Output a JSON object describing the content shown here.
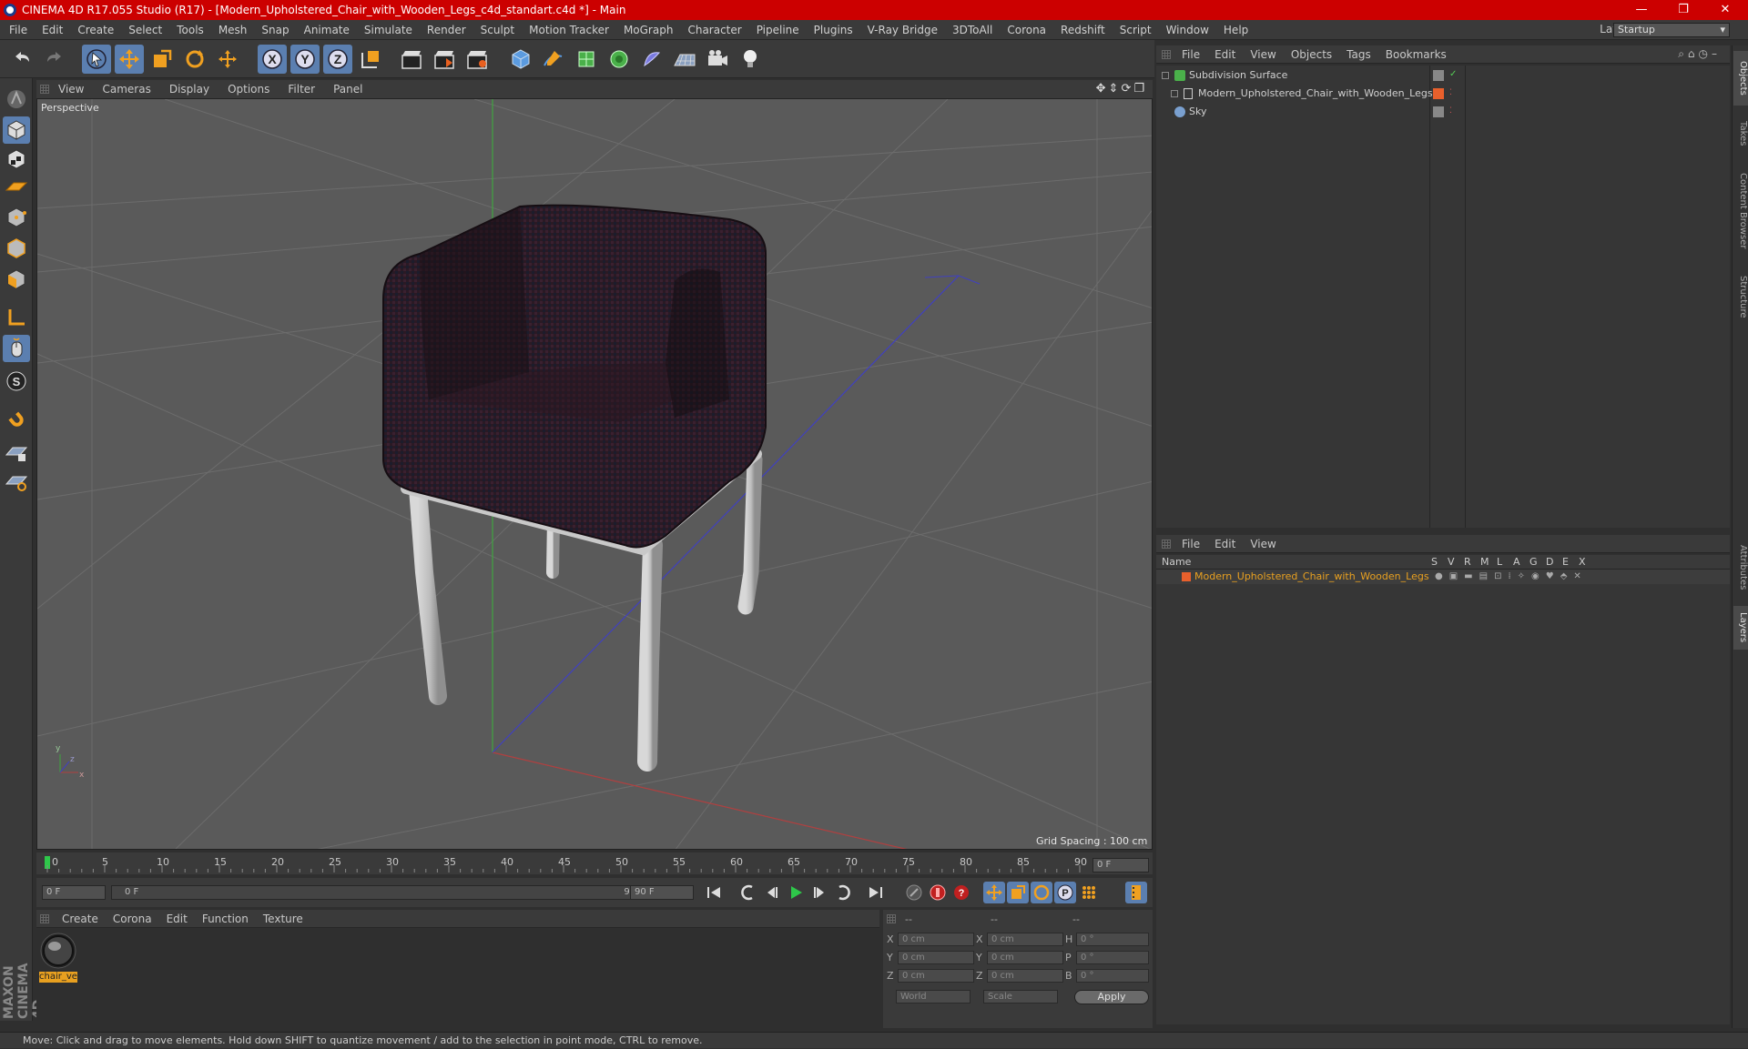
{
  "window": {
    "title": "CINEMA 4D R17.055 Studio (R17) - [Modern_Upholstered_Chair_with_Wooden_Legs_c4d_standart.c4d *] - Main",
    "minimize": "—",
    "maximize": "❐",
    "close": "✕"
  },
  "menu": [
    "File",
    "Edit",
    "Create",
    "Select",
    "Tools",
    "Mesh",
    "Snap",
    "Animate",
    "Simulate",
    "Render",
    "Sculpt",
    "Motion Tracker",
    "MoGraph",
    "Character",
    "Pipeline",
    "Plugins",
    "V-Ray Bridge",
    "3DToAll",
    "Corona",
    "Redshift",
    "Script",
    "Window",
    "Help"
  ],
  "layout": {
    "label": "Layout:",
    "value": "Startup"
  },
  "viewport": {
    "menu": [
      "View",
      "Cameras",
      "Display",
      "Options",
      "Filter",
      "Panel"
    ],
    "camera": "Perspective",
    "grid_spacing": "Grid Spacing : 100 cm"
  },
  "timeline": {
    "ticks": [
      "0",
      "5",
      "10",
      "15",
      "20",
      "25",
      "30",
      "35",
      "40",
      "45",
      "50",
      "55",
      "60",
      "65",
      "70",
      "75",
      "80",
      "85",
      "90"
    ],
    "current_frame": "0 F",
    "start": "0 F",
    "range_start": "0 F",
    "range_end": "90 F",
    "end": "90 F"
  },
  "material_manager": {
    "menu": [
      "Create",
      "Corona",
      "Edit",
      "Function",
      "Texture"
    ],
    "material_name": "chair_ve"
  },
  "coordinates": {
    "header": [
      "--",
      "--",
      "--"
    ],
    "rows": [
      {
        "a": "X",
        "av": "0 cm",
        "b": "X",
        "bv": "0 cm",
        "c": "H",
        "cv": "0 °"
      },
      {
        "a": "Y",
        "av": "0 cm",
        "b": "Y",
        "bv": "0 cm",
        "c": "P",
        "cv": "0 °"
      },
      {
        "a": "Z",
        "av": "0 cm",
        "b": "Z",
        "bv": "0 cm",
        "c": "B",
        "cv": "0 °"
      }
    ],
    "mode": "World",
    "scale": "Scale",
    "apply": "Apply"
  },
  "object_manager": {
    "menu": [
      "File",
      "Edit",
      "View",
      "Objects",
      "Tags",
      "Bookmarks"
    ],
    "objects": [
      {
        "name": "Subdivision Surface"
      },
      {
        "name": "Modern_Upholstered_Chair_with_Wooden_Legs"
      },
      {
        "name": "Sky"
      }
    ]
  },
  "layer_manager": {
    "menu": [
      "File",
      "Edit",
      "View"
    ],
    "columns": [
      "Name",
      "S",
      "V",
      "R",
      "M",
      "L",
      "A",
      "G",
      "D",
      "E",
      "X"
    ],
    "layer": "Modern_Upholstered_Chair_with_Wooden_Legs"
  },
  "right_tabs": [
    "Objects",
    "Takes",
    "Content Browser",
    "Structure",
    "Attributes",
    "Layers"
  ],
  "status": "Move: Click and drag to move elements. Hold down SHIFT to quantize movement / add to the selection in point mode, CTRL to remove.",
  "brand": "MAXON CINEMA 4D",
  "colors": {
    "titlebar": "#cc0000",
    "accent": "#5b7fb0",
    "layer_color": "#e8602c",
    "layer_text": "#e8a020"
  }
}
